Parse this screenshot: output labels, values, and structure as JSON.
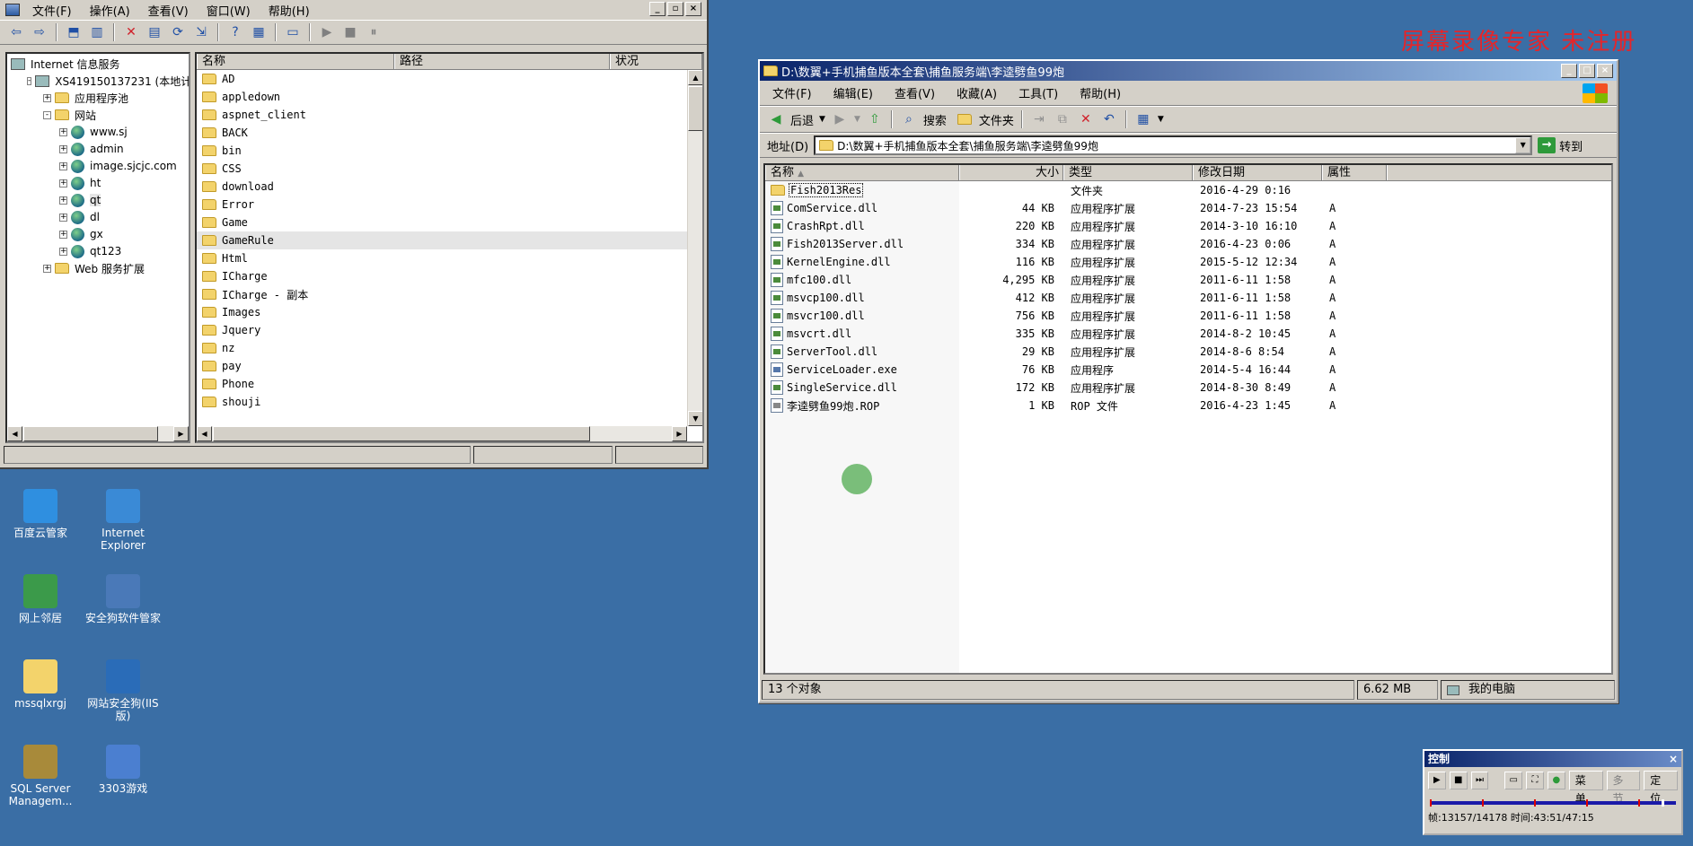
{
  "watermark": "屏幕录像专家 未注册",
  "iis": {
    "menu": [
      "文件(F)",
      "操作(A)",
      "查看(V)",
      "窗口(W)",
      "帮助(H)"
    ],
    "tree": [
      {
        "label": "Internet 信息服务",
        "indent": 0,
        "icon": "computer-icon",
        "pm": ""
      },
      {
        "label": "XS419150137231 (本地计",
        "indent": 1,
        "icon": "computer-icon",
        "pm": "-"
      },
      {
        "label": "应用程序池",
        "indent": 2,
        "icon": "folder-icon",
        "pm": "+"
      },
      {
        "label": "网站",
        "indent": 2,
        "icon": "folder-icon",
        "pm": "-"
      },
      {
        "label": "www.sj",
        "indent": 3,
        "icon": "globe-icon",
        "pm": "+"
      },
      {
        "label": "admin",
        "indent": 3,
        "icon": "globe-icon",
        "pm": "+"
      },
      {
        "label": "image.sjcjc.com",
        "indent": 3,
        "icon": "globe-icon",
        "pm": "+"
      },
      {
        "label": "ht",
        "indent": 3,
        "icon": "globe-icon",
        "pm": "+"
      },
      {
        "label": "qt",
        "indent": 3,
        "icon": "globe-icon",
        "pm": "+"
      },
      {
        "label": "dl",
        "indent": 3,
        "icon": "globe-icon",
        "pm": "+"
      },
      {
        "label": "gx",
        "indent": 3,
        "icon": "globe-icon",
        "pm": "+"
      },
      {
        "label": "qt123",
        "indent": 3,
        "icon": "globe-icon",
        "pm": "+"
      },
      {
        "label": "Web 服务扩展",
        "indent": 2,
        "icon": "folder-icon",
        "pm": "+"
      }
    ],
    "columns": [
      "名称",
      "路径",
      "状况"
    ],
    "folders": [
      "AD",
      "appledown",
      "aspnet_client",
      "BACK",
      "bin",
      "CSS",
      "download",
      "Error",
      "Game",
      "GameRule",
      "Html",
      "ICharge",
      "ICharge - 副本",
      "Images",
      "Jquery",
      "nz",
      "pay",
      "Phone",
      "shouji"
    ],
    "selected_folder": "GameRule"
  },
  "explorer": {
    "title": "D:\\数翼+手机捕鱼版本全套\\捕鱼服务端\\李逵劈鱼99炮",
    "menu": [
      "文件(F)",
      "编辑(E)",
      "查看(V)",
      "收藏(A)",
      "工具(T)",
      "帮助(H)"
    ],
    "toolbar": {
      "back": "后退",
      "search": "搜索",
      "folders": "文件夹"
    },
    "address_label": "地址(D)",
    "address_value": "D:\\数翼+手机捕鱼版本全套\\捕鱼服务端\\李逵劈鱼99炮",
    "go_label": "转到",
    "columns": [
      "名称",
      "大小",
      "类型",
      "修改日期",
      "属性"
    ],
    "files": [
      {
        "name": "Fish2013Res",
        "size": "",
        "type": "文件夹",
        "date": "2016-4-29 0:16",
        "attr": "",
        "icon": "folder"
      },
      {
        "name": "ComService.dll",
        "size": "44 KB",
        "type": "应用程序扩展",
        "date": "2014-7-23 15:54",
        "attr": "A",
        "icon": "dll"
      },
      {
        "name": "CrashRpt.dll",
        "size": "220 KB",
        "type": "应用程序扩展",
        "date": "2014-3-10 16:10",
        "attr": "A",
        "icon": "dll"
      },
      {
        "name": "Fish2013Server.dll",
        "size": "334 KB",
        "type": "应用程序扩展",
        "date": "2016-4-23 0:06",
        "attr": "A",
        "icon": "dll"
      },
      {
        "name": "KernelEngine.dll",
        "size": "116 KB",
        "type": "应用程序扩展",
        "date": "2015-5-12 12:34",
        "attr": "A",
        "icon": "dll"
      },
      {
        "name": "mfc100.dll",
        "size": "4,295 KB",
        "type": "应用程序扩展",
        "date": "2011-6-11 1:58",
        "attr": "A",
        "icon": "dll"
      },
      {
        "name": "msvcp100.dll",
        "size": "412 KB",
        "type": "应用程序扩展",
        "date": "2011-6-11 1:58",
        "attr": "A",
        "icon": "dll"
      },
      {
        "name": "msvcr100.dll",
        "size": "756 KB",
        "type": "应用程序扩展",
        "date": "2011-6-11 1:58",
        "attr": "A",
        "icon": "dll"
      },
      {
        "name": "msvcrt.dll",
        "size": "335 KB",
        "type": "应用程序扩展",
        "date": "2014-8-2 10:45",
        "attr": "A",
        "icon": "dll"
      },
      {
        "name": "ServerTool.dll",
        "size": "29 KB",
        "type": "应用程序扩展",
        "date": "2014-8-6 8:54",
        "attr": "A",
        "icon": "dll"
      },
      {
        "name": "ServiceLoader.exe",
        "size": "76 KB",
        "type": "应用程序",
        "date": "2014-5-4 16:44",
        "attr": "A",
        "icon": "exe"
      },
      {
        "name": "SingleService.dll",
        "size": "172 KB",
        "type": "应用程序扩展",
        "date": "2014-8-30 8:49",
        "attr": "A",
        "icon": "dll"
      },
      {
        "name": "李逵劈鱼99炮.ROP",
        "size": "1 KB",
        "type": "ROP 文件",
        "date": "2016-4-23 1:45",
        "attr": "A",
        "icon": "rop"
      }
    ],
    "status": {
      "count": "13 个对象",
      "size": "6.62 MB",
      "location": "我的电脑"
    }
  },
  "desktop_icons": [
    {
      "label": "百度云管家",
      "color": "#2f8fe0"
    },
    {
      "label": "Internet Explorer",
      "color": "#3a8ad6"
    },
    {
      "label": "网上邻居",
      "color": "#3b9a4a"
    },
    {
      "label": "安全狗软件管家",
      "color": "#4a79b8"
    },
    {
      "label": "mssqlxrgj",
      "color": "#f3d36b"
    },
    {
      "label": "网站安全狗(IIS版)",
      "color": "#2a6cb8"
    },
    {
      "label": "SQL Server Managem...",
      "color": "#a88a3a"
    },
    {
      "label": "3303游戏",
      "color": "#4b7fd0"
    }
  ],
  "control": {
    "title": "控制",
    "buttons": [
      "菜单",
      "多节",
      "定位"
    ],
    "status": "帧:13157/14178 时间:43:51/47:15"
  }
}
